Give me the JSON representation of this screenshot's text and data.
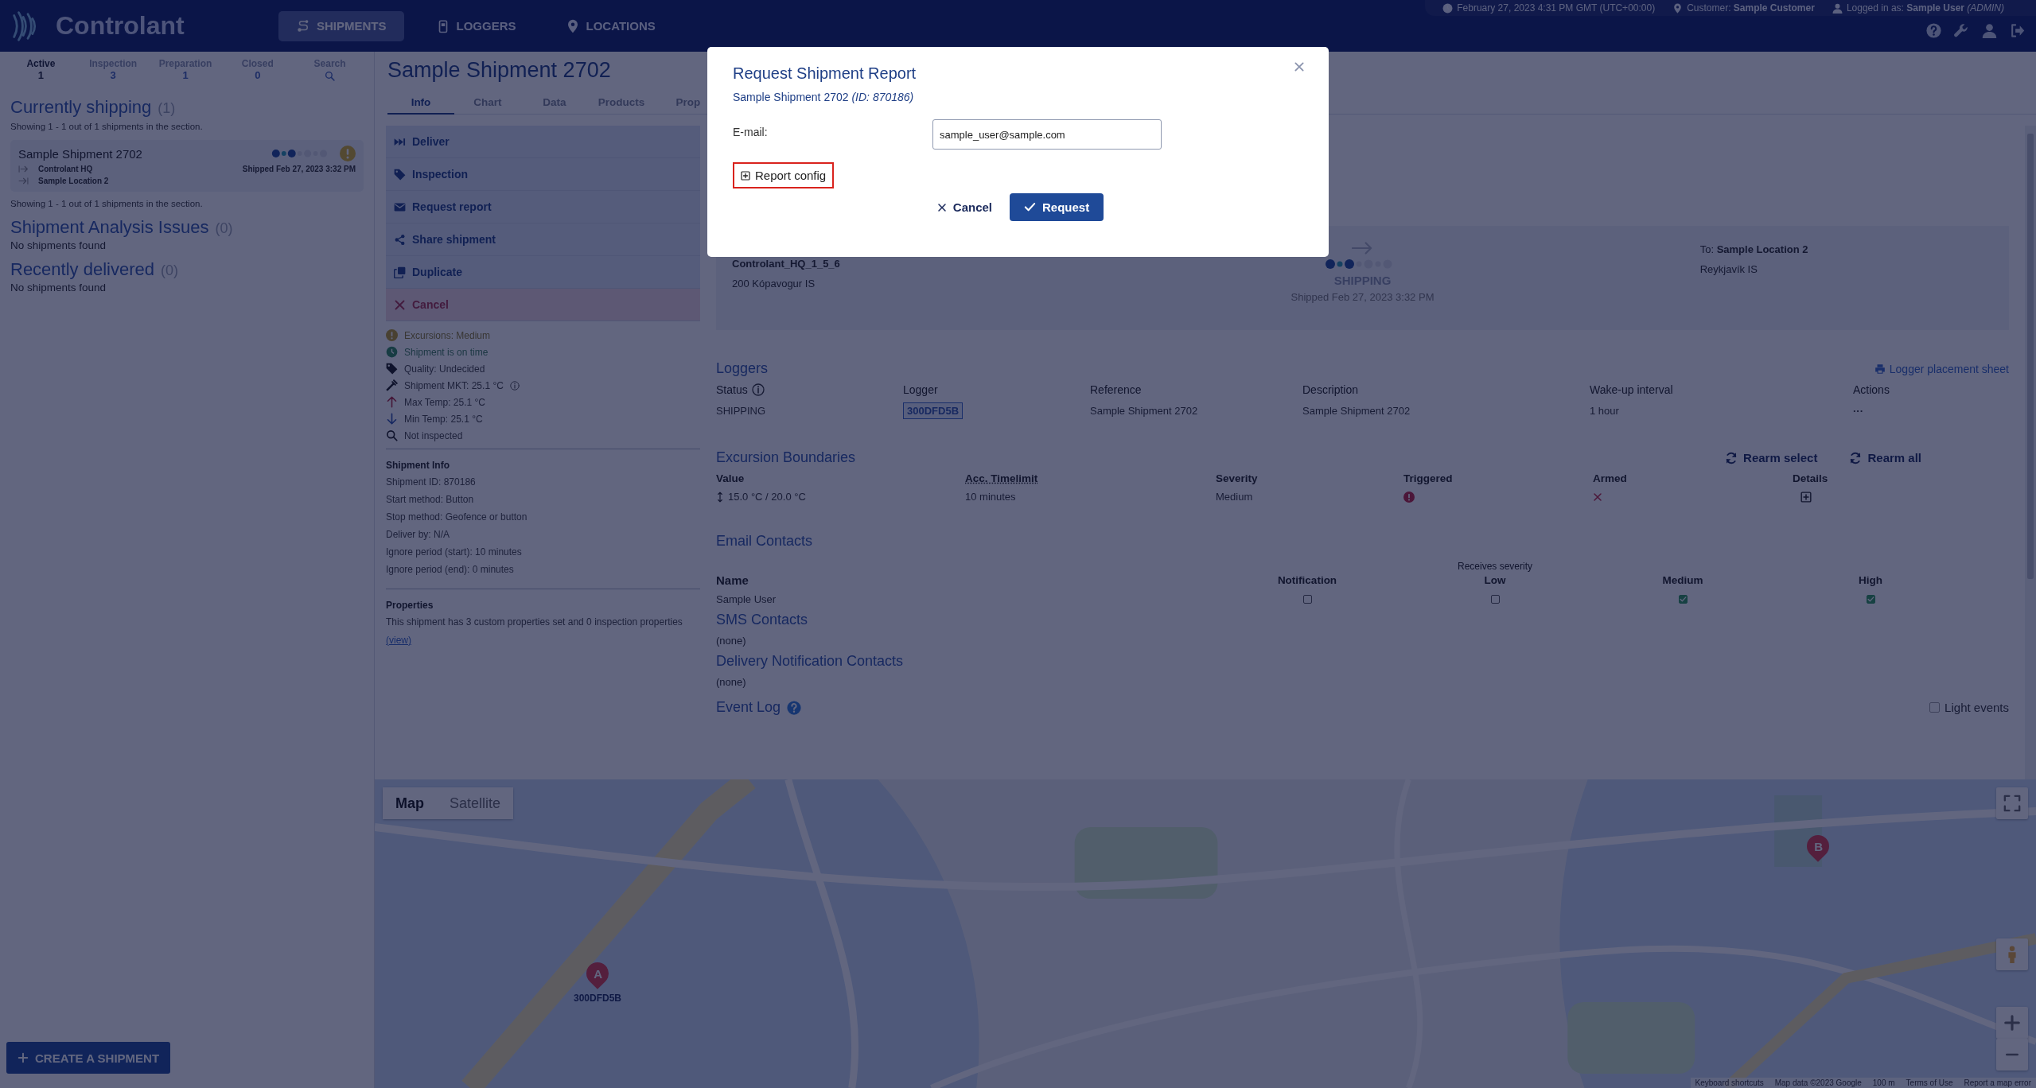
{
  "header": {
    "brand": "Controlant",
    "nav": [
      {
        "label": "SHIPMENTS",
        "kind": "route",
        "selected": true
      },
      {
        "label": "LOGGERS",
        "kind": "device",
        "selected": false
      },
      {
        "label": "LOCATIONS",
        "kind": "pin",
        "selected": false
      }
    ],
    "info_bar": {
      "datetime": "February 27, 2023 4:31 PM GMT (UTC+00:00)",
      "customer_label": "Customer:",
      "customer": "Sample Customer",
      "login_label": "Logged in as:",
      "user": "Sample User",
      "role": "(ADMIN)"
    }
  },
  "sidebar": {
    "tabs": [
      {
        "label": "Active",
        "count": "1",
        "selected": true
      },
      {
        "label": "Inspection",
        "count": "3",
        "selected": false
      },
      {
        "label": "Preparation",
        "count": "1",
        "selected": false
      },
      {
        "label": "Closed",
        "count": "0",
        "selected": false
      },
      {
        "label": "Search",
        "kind": "search",
        "selected": false
      }
    ],
    "currently_shipping": {
      "title": "Currently shipping",
      "count": "(1)",
      "showing": "Showing 1 - 1 out of 1 shipments in the section.",
      "shipments": [
        {
          "name": "Sample Shipment 2702",
          "warning": true,
          "from": "Controlant HQ",
          "to": "Sample Location 2",
          "shipped": "Shipped Feb 27, 2023 3:32 PM"
        }
      ],
      "showing_after": "Showing 1 - 1 out of 1 shipments in the section."
    },
    "sections": [
      {
        "title": "Shipment Analysis Issues",
        "count": "(0)",
        "empty": "No shipments found"
      },
      {
        "title": "Recently delivered",
        "count": "(0)",
        "empty": "No shipments found"
      }
    ],
    "create_button": "CREATE A SHIPMENT"
  },
  "main": {
    "title": "Sample Shipment 2702",
    "tabs": [
      {
        "label": "Info",
        "selected": true
      },
      {
        "label": "Chart",
        "selected": false
      },
      {
        "label": "Data",
        "selected": false
      },
      {
        "label": "Products",
        "selected": false
      },
      {
        "label": "Prop",
        "selected": false
      }
    ],
    "actions": [
      {
        "label": "Deliver",
        "kind": "deliver"
      },
      {
        "label": "Inspection",
        "kind": "inspection"
      },
      {
        "label": "Request report",
        "kind": "report"
      },
      {
        "label": "Share shipment",
        "kind": "share"
      },
      {
        "label": "Duplicate",
        "kind": "duplicate"
      },
      {
        "label": "Cancel",
        "kind": "cancel"
      }
    ],
    "status_list": [
      {
        "kind": "excursion",
        "text": "Excursions: Medium",
        "has_info": false
      },
      {
        "kind": "time",
        "text": "Shipment is on time",
        "has_info": false
      },
      {
        "kind": "quality",
        "text": "Quality: Undecided",
        "has_info": false
      },
      {
        "kind": "mkt",
        "text": "Shipment MKT: 25.1 °C",
        "has_info": true
      },
      {
        "kind": "max",
        "text": "Max Temp: 25.1 °C",
        "has_info": false
      },
      {
        "kind": "min",
        "text": "Min Temp: 25.1 °C",
        "has_info": false
      },
      {
        "kind": "inspected",
        "text": "Not inspected",
        "has_info": false
      }
    ],
    "shipment_info": {
      "title": "Shipment Info",
      "lines": [
        "Shipment ID: 870186",
        "Start method: Button",
        "Stop method: Geofence or button",
        "Deliver by: N/A",
        "Ignore period (start): 10 minutes",
        "Ignore period (end): 0 minutes"
      ]
    },
    "properties": {
      "title": "Properties",
      "text": "This shipment has 3 custom properties set and 0 inspection properties",
      "link": "(view)"
    },
    "route": {
      "from_code": "Controlant_HQ_1_5_6",
      "from_address": "200 Kópavogur IS",
      "status": "SHIPPING",
      "shipped": "Shipped Feb 27, 2023 3:32 PM",
      "to_label": "To:",
      "to": "Sample Location 2",
      "to_address": "Reykjavík IS"
    },
    "loggers": {
      "title": "Loggers",
      "link": "Logger placement sheet",
      "columns": [
        "Status",
        "Logger",
        "Reference",
        "Description",
        "Wake-up interval",
        "Actions"
      ],
      "rows": [
        {
          "status": "SHIPPING",
          "logger": "300DFD5B",
          "reference": "Sample Shipment 2702",
          "description": "Sample Shipment 2702",
          "wake_up": "1 hour",
          "actions": "···"
        }
      ]
    },
    "excursion": {
      "title": "Excursion Boundaries",
      "buttons": [
        "Rearm select",
        "Rearm all"
      ],
      "columns": [
        {
          "label": "Value",
          "underlined": false
        },
        {
          "label": "Acc. Timelimit",
          "underlined": true
        },
        {
          "label": "Severity",
          "underlined": false
        },
        {
          "label": "Triggered",
          "underlined": false
        },
        {
          "label": "Armed",
          "underlined": false
        },
        {
          "label": "Details",
          "underlined": false
        }
      ],
      "rows": [
        {
          "value": "15.0 °C / 20.0 °C",
          "timelimit": "10 minutes",
          "severity": "Medium",
          "triggered": true,
          "armed": false
        }
      ]
    },
    "email": {
      "title": "Email Contacts",
      "group_label": "Receives severity",
      "columns": [
        "Name",
        "Notification",
        "Low",
        "Medium",
        "High"
      ],
      "rows": [
        {
          "name": "Sample User",
          "notification": false,
          "low": false,
          "medium": true,
          "high": true
        }
      ]
    },
    "sms": {
      "title": "SMS Contacts",
      "text": "(none)"
    },
    "delivery": {
      "title": "Delivery Notification Contacts",
      "text": "(none)"
    },
    "event_log": {
      "title": "Event Log",
      "light_events": {
        "label": "Light events",
        "checked": false
      }
    }
  },
  "map": {
    "types": [
      {
        "label": "Map",
        "selected": true
      },
      {
        "label": "Satellite",
        "selected": false
      }
    ],
    "pins": [
      {
        "label": "A",
        "caption": "300DFD5B"
      },
      {
        "label": "B"
      }
    ],
    "footer": [
      "Keyboard shortcuts",
      "Map data ©2023 Google",
      "100 m",
      "Terms of Use",
      "Report a map error"
    ]
  },
  "modal": {
    "title": "Request Shipment Report",
    "subtitle": "Sample Shipment 2702 *(ID: 870186)*",
    "email_label": "E-mail:",
    "email_value": "sample_user@sample.com",
    "report_config": {
      "label": "Report config",
      "expanded": false,
      "highlighted": true
    },
    "cancel": "Cancel",
    "request": "Request"
  }
}
